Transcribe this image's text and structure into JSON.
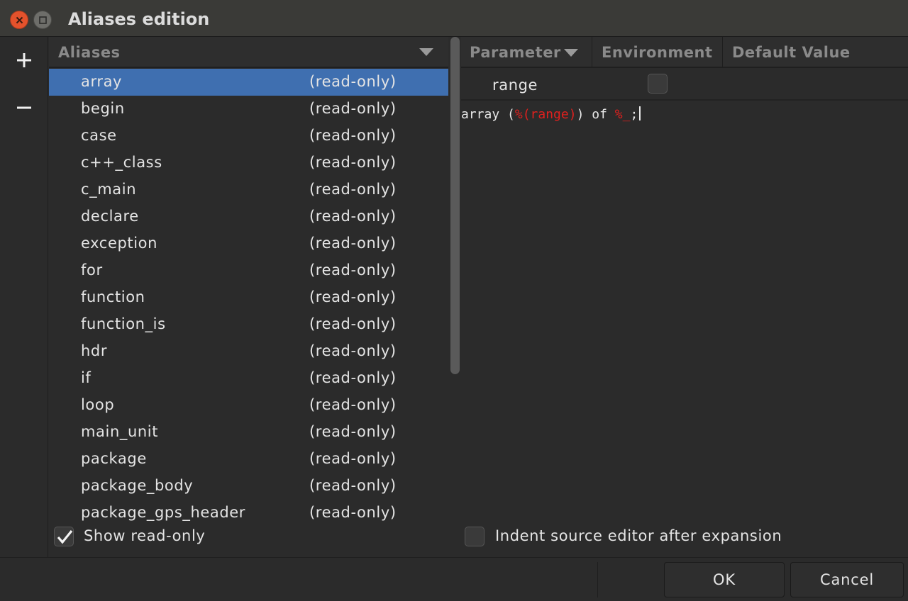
{
  "window": {
    "title": "Aliases edition"
  },
  "aliases": {
    "header": "Aliases",
    "items": [
      {
        "name": "array",
        "status": "(read-only)"
      },
      {
        "name": "begin",
        "status": "(read-only)"
      },
      {
        "name": "case",
        "status": "(read-only)"
      },
      {
        "name": "c++_class",
        "status": "(read-only)"
      },
      {
        "name": "c_main",
        "status": "(read-only)"
      },
      {
        "name": "declare",
        "status": "(read-only)"
      },
      {
        "name": "exception",
        "status": "(read-only)"
      },
      {
        "name": "for",
        "status": "(read-only)"
      },
      {
        "name": "function",
        "status": "(read-only)"
      },
      {
        "name": "function_is",
        "status": "(read-only)"
      },
      {
        "name": "hdr",
        "status": "(read-only)"
      },
      {
        "name": "if",
        "status": "(read-only)"
      },
      {
        "name": "loop",
        "status": "(read-only)"
      },
      {
        "name": "main_unit",
        "status": "(read-only)"
      },
      {
        "name": "package",
        "status": "(read-only)"
      },
      {
        "name": "package_body",
        "status": "(read-only)"
      },
      {
        "name": "package_gps_header",
        "status": "(read-only)"
      }
    ],
    "show_readonly_label": "Show read-only",
    "show_readonly_checked": true
  },
  "parameters": {
    "columns": [
      "Parameter",
      "Environment",
      "Default Value"
    ],
    "rows": [
      {
        "name": "range",
        "environment": false,
        "default": ""
      }
    ]
  },
  "editor": {
    "parts": [
      "array (",
      "%(range)",
      ") of ",
      "%_",
      ";"
    ]
  },
  "indent_option": {
    "label": "Indent source editor after expansion",
    "checked": false
  },
  "buttons": {
    "ok": "OK",
    "cancel": "Cancel"
  },
  "colors": {
    "selection": "#3f6fb0",
    "param_highlight": "#e0201e"
  }
}
